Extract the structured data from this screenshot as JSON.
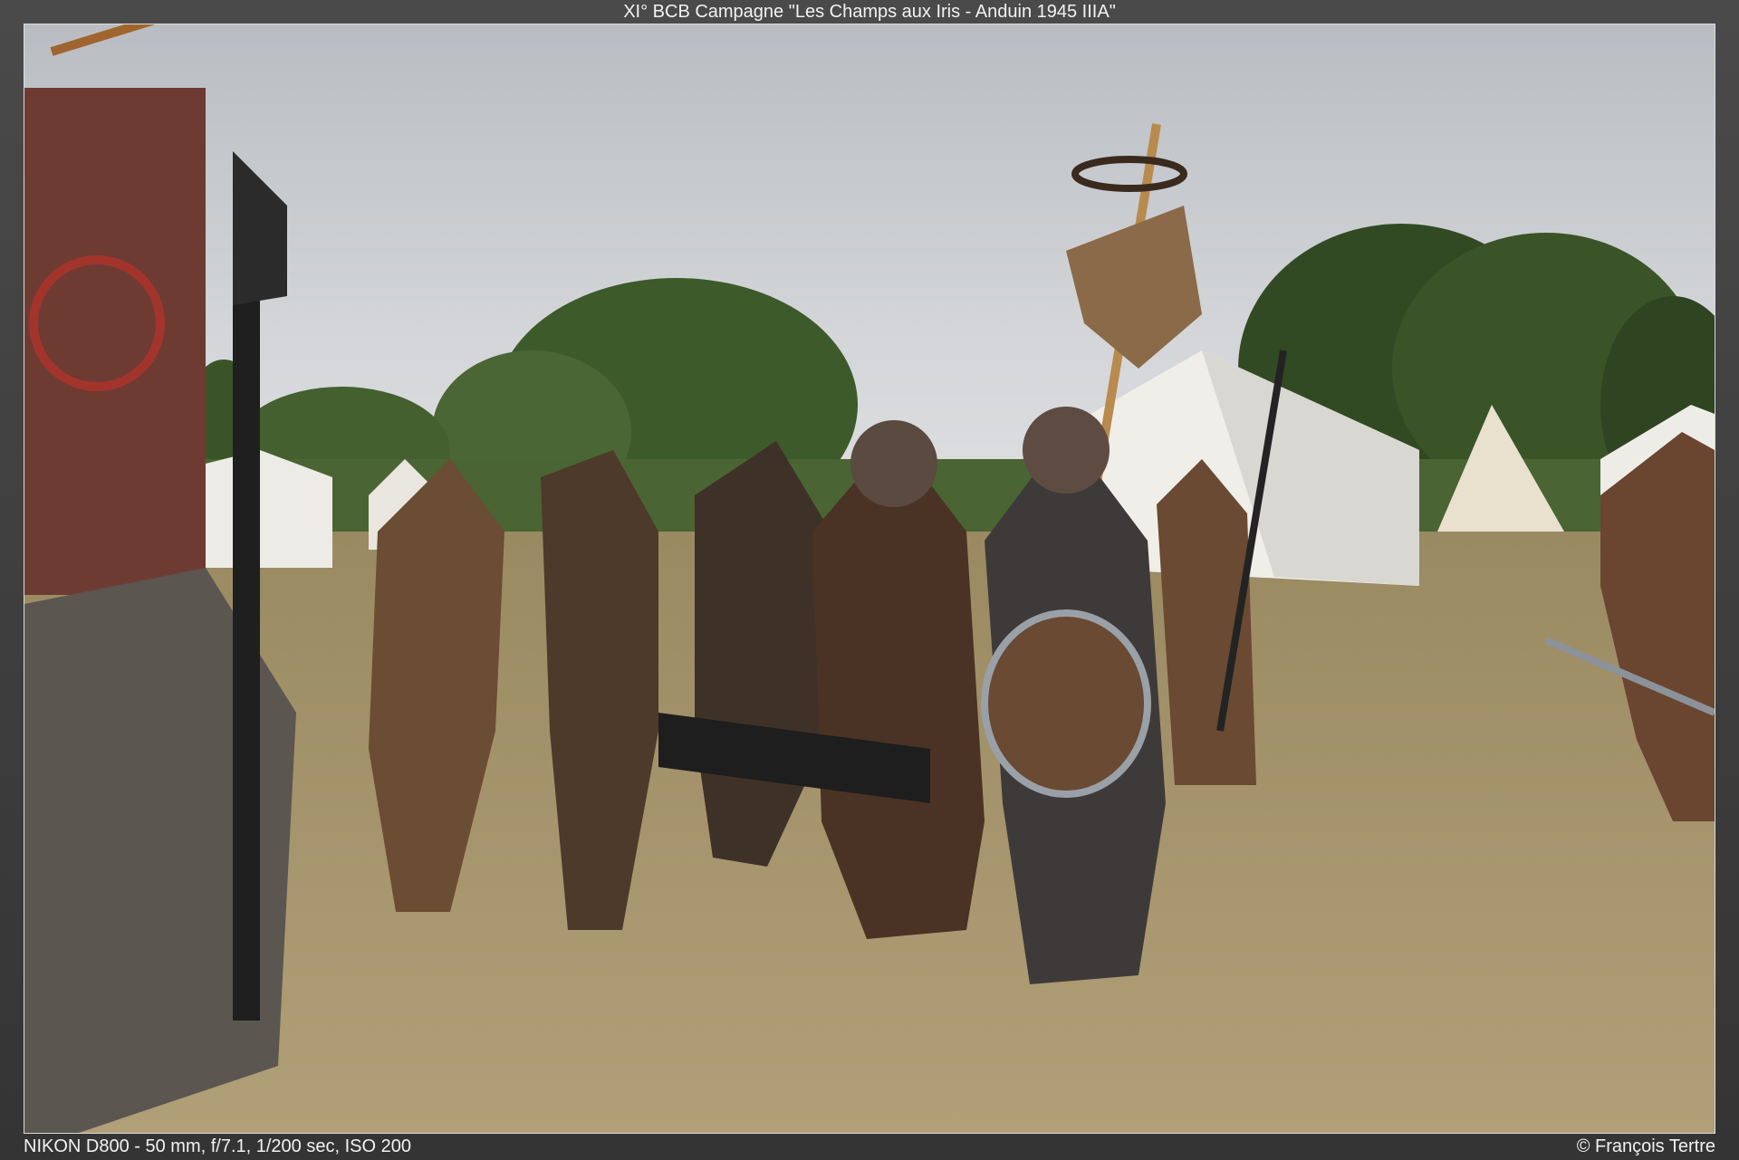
{
  "caption": {
    "title": "XI° BCB Campagne \"Les Champs aux Iris - Anduin 1945 IIIA\"",
    "exif": "NIKON D800 - 50 mm, f/7.1, 1/200 sec, ISO 200",
    "credit": "© François Tertre"
  },
  "colors": {
    "sky": "#c9ccd0",
    "trees": "#3f5a2c",
    "field": "#a08e66",
    "tents": "#ecebe6",
    "leather": "#5a3a24"
  }
}
